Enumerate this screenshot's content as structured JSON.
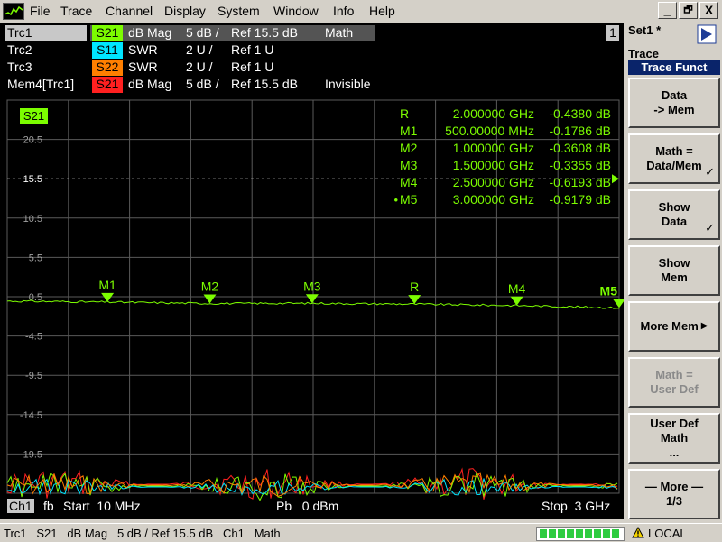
{
  "menu": {
    "items": [
      "File",
      "Trace",
      "Channel",
      "Display",
      "System",
      "Window",
      "Info",
      "Help"
    ]
  },
  "window_buttons": {
    "minimize": "_",
    "restore": "🗗",
    "close": "X"
  },
  "channel_number": "1",
  "traces": [
    {
      "name": "Trc1",
      "meas": "S21",
      "meas_color": "#7cfc00",
      "format": "dB Mag",
      "scale": "5 dB /",
      "ref": "Ref 15.5 dB",
      "extra": "Math",
      "active": true
    },
    {
      "name": "Trc2",
      "meas": "S11",
      "meas_color": "#00e5ff",
      "format": "SWR",
      "scale": "2 U /",
      "ref": "Ref 1 U",
      "extra": "",
      "active": false
    },
    {
      "name": "Trc3",
      "meas": "S22",
      "meas_color": "#ff7f00",
      "format": "SWR",
      "scale": "2 U /",
      "ref": "Ref 1 U",
      "extra": "",
      "active": false
    },
    {
      "name": "Mem4[Trc1]",
      "meas": "S21",
      "meas_color": "#ff2020",
      "format": "dB Mag",
      "scale": "5 dB /",
      "ref": "Ref 15.5 dB",
      "extra": "Invisible",
      "active": false
    }
  ],
  "diagram": {
    "trace_label": "S21",
    "y_ticks": [
      20.5,
      15.5,
      10.5,
      5.5,
      0.5,
      -4.5,
      -9.5,
      -14.5,
      -19.5
    ],
    "y_tick_labels": [
      "20.5",
      "15.5",
      "10.5",
      "5.5",
      "0.5",
      "-4.5",
      "-9.5",
      "-14.5",
      "-19.5"
    ],
    "ref_level": 15.5,
    "y_range": [
      -24.5,
      25.5
    ],
    "x_range_ghz": [
      0.01,
      3.0
    ],
    "grid": true
  },
  "marker_table": [
    {
      "name": "R",
      "freq": "2.000000 GHz",
      "value": "-0.4380 dB",
      "prefix": ""
    },
    {
      "name": "M1",
      "freq": "500.00000 MHz",
      "value": "-0.1786 dB",
      "prefix": ""
    },
    {
      "name": "M2",
      "freq": "1.000000 GHz",
      "value": "-0.3608 dB",
      "prefix": ""
    },
    {
      "name": "M3",
      "freq": "1.500000 GHz",
      "value": "-0.3355 dB",
      "prefix": ""
    },
    {
      "name": "M4",
      "freq": "2.500000 GHz",
      "value": "-0.6193 dB",
      "prefix": ""
    },
    {
      "name": "M5",
      "freq": "3.000000 GHz",
      "value": "-0.9179 dB",
      "prefix": "•"
    }
  ],
  "markers": [
    {
      "label": "M1",
      "x_ghz": 0.5,
      "y": -0.1786
    },
    {
      "label": "M2",
      "x_ghz": 1.0,
      "y": -0.3608
    },
    {
      "label": "M3",
      "x_ghz": 1.5,
      "y": -0.3355
    },
    {
      "label": "R",
      "x_ghz": 2.0,
      "y": -0.438
    },
    {
      "label": "M4",
      "x_ghz": 2.5,
      "y": -0.6193
    },
    {
      "label": "M5",
      "x_ghz": 3.0,
      "y": -0.9179
    }
  ],
  "status": {
    "channel": "Ch1",
    "fb": "fb",
    "start": "Start  10 MHz",
    "power": "Pb   0 dBm",
    "stop": "Stop  3 GHz"
  },
  "softpanel": {
    "set_title": "Set1 *",
    "section_title": "Trace",
    "menu_title": "Trace Funct",
    "keys": [
      {
        "label": "Data\n-> Mem",
        "checked": false,
        "disabled": false,
        "arrow": false
      },
      {
        "label": "Math =\nData/Mem",
        "checked": true,
        "disabled": false,
        "arrow": false
      },
      {
        "label": "Show\nData",
        "checked": true,
        "disabled": false,
        "arrow": false
      },
      {
        "label": "Show\nMem",
        "checked": false,
        "disabled": false,
        "arrow": false
      },
      {
        "label": "More Mem",
        "checked": false,
        "disabled": false,
        "arrow": true
      },
      {
        "label": "Math =\nUser Def",
        "checked": false,
        "disabled": true,
        "arrow": false
      },
      {
        "label": "User Def\nMath\n...",
        "checked": false,
        "disabled": false,
        "arrow": false
      },
      {
        "label": "— More —\n1/3",
        "checked": false,
        "disabled": false,
        "arrow": false
      }
    ]
  },
  "bottom_status": "Trc1   S21   dB Mag   5 dB / Ref 15.5 dB   Ch1   Math",
  "bottom_right": {
    "mode": "LOCAL",
    "progress_segments": 9
  },
  "colors": {
    "trace_green": "#7cfc00",
    "grid": "#5a5a5a",
    "title_bar": "#0a246a"
  }
}
